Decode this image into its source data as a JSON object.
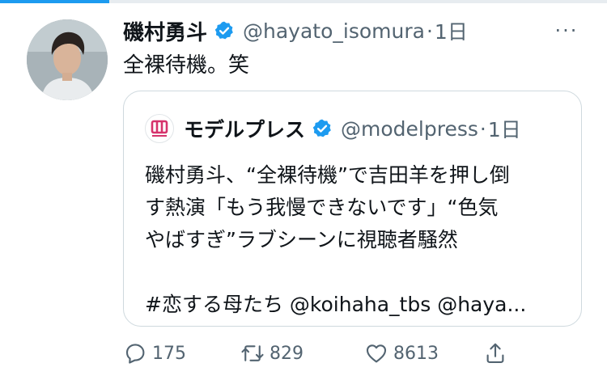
{
  "tweet": {
    "author_name": "磯村勇斗",
    "author_handle": "@hayato_isomura",
    "separator": "·",
    "time": "1日",
    "text": "全裸待機。笑",
    "more": "···"
  },
  "quote": {
    "author_name": "モデルプレス",
    "author_handle": "@modelpress",
    "separator": "·",
    "time": "1日",
    "lines": [
      "磯村勇斗、“全裸待機”で吉田羊を押し倒",
      "す熱演「もう我慢できないです」“色気",
      "やばすぎ”ラブシーンに視聴者騒然",
      "",
      "#恋する母たち @koihaha_tbs @haya..."
    ]
  },
  "actions": {
    "reply_count": "175",
    "retweet_count": "829",
    "like_count": "8613"
  },
  "colors": {
    "accent": "#1d9bf0",
    "secondary_text": "#536471",
    "border": "#cfd9de",
    "modelpress_brand": "#d6336c"
  },
  "icons": {
    "verified": "verified-badge-icon",
    "reply": "reply-icon",
    "retweet": "retweet-icon",
    "like": "heart-icon",
    "share": "share-icon",
    "more": "more-options-icon"
  }
}
